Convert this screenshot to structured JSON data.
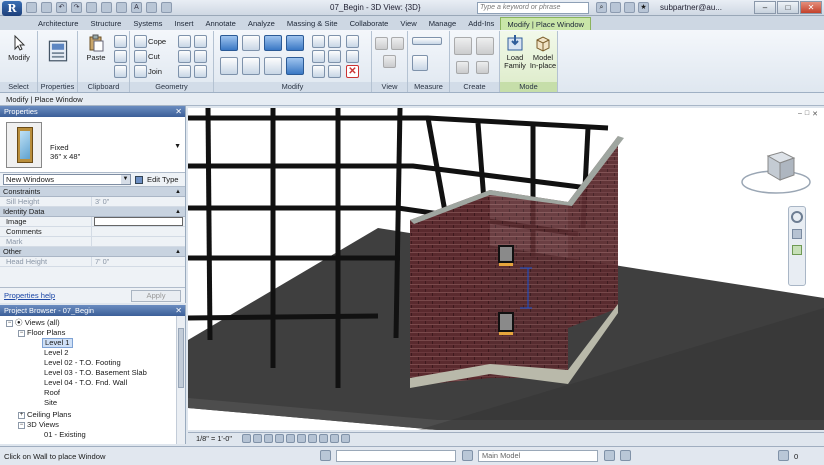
{
  "titlebar": {
    "app_letter": "R",
    "title": "07_Begin - 3D View: {3D}",
    "search_placeholder": "Type a keyword or phrase",
    "user": "subpartner@au..."
  },
  "tabs": [
    "Architecture",
    "Structure",
    "Systems",
    "Insert",
    "Annotate",
    "Analyze",
    "Massing & Site",
    "Collaborate",
    "View",
    "Manage",
    "Add-Ins",
    "Modify | Place Window"
  ],
  "ribbon": {
    "select": {
      "title": "Select",
      "modify_label": "Modify"
    },
    "properties": {
      "title": "Properties"
    },
    "clipboard": {
      "title": "Clipboard",
      "paste_label": "Paste"
    },
    "geometry": {
      "title": "Geometry",
      "cope_label": "Cope",
      "cut_label": "Cut",
      "join_label": "Join"
    },
    "modify": {
      "title": "Modify"
    },
    "view": {
      "title": "View"
    },
    "measure": {
      "title": "Measure"
    },
    "create": {
      "title": "Create"
    },
    "mode": {
      "title": "Mode",
      "load_family_label": "Load Family",
      "model_inplace_label": "Model In-place"
    }
  },
  "options_bar": {
    "text": "Modify | Place Window"
  },
  "properties_palette": {
    "header": "Properties",
    "type_name_line1": "Fixed",
    "type_name_line2": "36\" x 48\"",
    "filter_value": "New Windows",
    "edit_type_label": "Edit Type",
    "groups": [
      {
        "name": "Constraints",
        "rows": [
          {
            "key": "Sill Height",
            "value": "3' 0\"",
            "dim": true
          }
        ]
      },
      {
        "name": "Identity Data",
        "rows": [
          {
            "key": "Image",
            "value": "",
            "dim": false
          },
          {
            "key": "Comments",
            "value": "",
            "dim": false
          },
          {
            "key": "Mark",
            "value": "",
            "dim": true
          }
        ]
      },
      {
        "name": "Other",
        "rows": [
          {
            "key": "Head Height",
            "value": "7' 0\"",
            "dim": true
          }
        ]
      }
    ],
    "help_link": "Properties help",
    "apply_label": "Apply"
  },
  "project_browser": {
    "header": "Project Browser - 07_Begin",
    "nodes": [
      {
        "label": "Views (all)",
        "indent": 0,
        "exp": "−"
      },
      {
        "label": "Floor Plans",
        "indent": 1,
        "exp": "−"
      },
      {
        "label": "Level 1",
        "indent": 2,
        "exp": "",
        "selected": true
      },
      {
        "label": "Level 2",
        "indent": 2,
        "exp": ""
      },
      {
        "label": "Level 02 - T.O. Footing",
        "indent": 2,
        "exp": ""
      },
      {
        "label": "Level 03 - T.O. Basement Slab",
        "indent": 2,
        "exp": ""
      },
      {
        "label": "Level 04 - T.O. Fnd. Wall",
        "indent": 2,
        "exp": ""
      },
      {
        "label": "Roof",
        "indent": 2,
        "exp": ""
      },
      {
        "label": "Site",
        "indent": 2,
        "exp": ""
      },
      {
        "label": "Ceiling Plans",
        "indent": 1,
        "exp": "+"
      },
      {
        "label": "3D Views",
        "indent": 1,
        "exp": "−"
      },
      {
        "label": "01 - Existing",
        "indent": 2,
        "exp": ""
      }
    ]
  },
  "viewport": {
    "viewcube_face": "TOP"
  },
  "view_control": {
    "scale": "1/8\" = 1'-0\""
  },
  "statusbar": {
    "text": "Click on Wall to place Window",
    "workset_value": "",
    "model_value": "Main Model",
    "filter_count": "0"
  },
  "colors": {
    "ribbon_context": "#c9e6a8",
    "brick": "#5a2a2e",
    "accent_blue": "#2f5d9a"
  }
}
